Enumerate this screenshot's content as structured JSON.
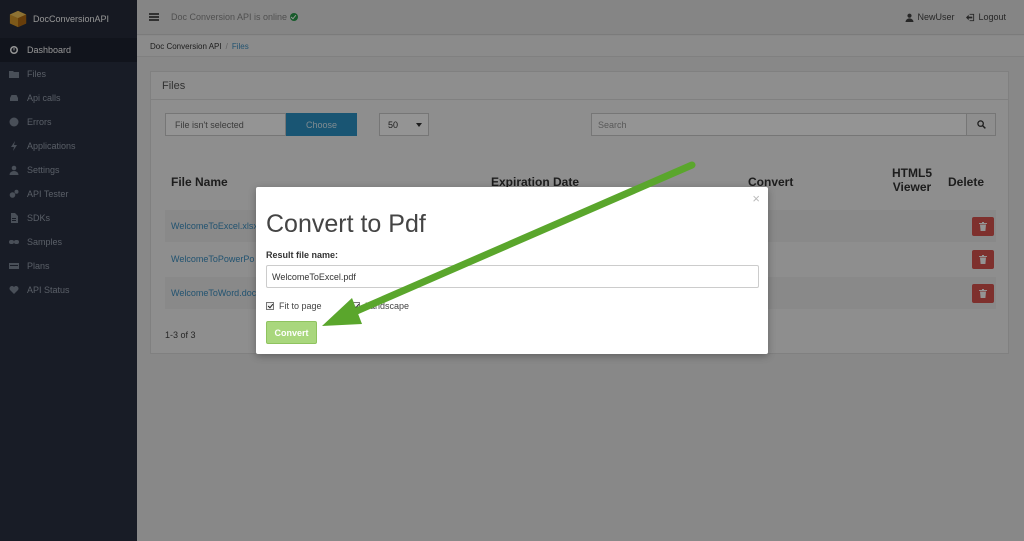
{
  "app": {
    "brand": "DocConversionAPI"
  },
  "topbar": {
    "status": "Doc Conversion API is online",
    "user": "NewUser",
    "logout": "Logout"
  },
  "sidebar": {
    "items": [
      {
        "label": "Dashboard",
        "icon": "dashboard-icon"
      },
      {
        "label": "Files",
        "icon": "folder-icon"
      },
      {
        "label": "Api calls",
        "icon": "car-icon"
      },
      {
        "label": "Errors",
        "icon": "error-icon"
      },
      {
        "label": "Applications",
        "icon": "bolt-icon"
      },
      {
        "label": "Settings",
        "icon": "user-icon"
      },
      {
        "label": "API Tester",
        "icon": "cogs-icon"
      },
      {
        "label": "SDKs",
        "icon": "file-icon"
      },
      {
        "label": "Samples",
        "icon": "link-icon"
      },
      {
        "label": "Plans",
        "icon": "credit-card-icon"
      },
      {
        "label": "API Status",
        "icon": "heart-icon"
      }
    ]
  },
  "breadcrumb": {
    "root": "Doc Conversion API",
    "sep": "/",
    "current": "Files"
  },
  "files": {
    "title": "Files",
    "file_input": "File isn't selected",
    "choose": "Choose",
    "page_size": "50",
    "search_placeholder": "Search",
    "headers": {
      "name": "File Name",
      "expiration": "Expiration Date",
      "convert": "Convert",
      "viewer_1": "HTML5",
      "viewer_2": "Viewer",
      "delete": "Delete"
    },
    "rows": [
      {
        "name": "WelcomeToExcel.xlsx"
      },
      {
        "name": "WelcomeToPowerPo"
      },
      {
        "name": "WelcomeToWord.doc"
      }
    ],
    "pager": "1-3 of 3"
  },
  "modal": {
    "title": "Convert to Pdf",
    "close": "×",
    "label": "Result file name:",
    "filename": "WelcomeToExcel.pdf",
    "fit_to_page": "Fit to page",
    "landscape": "Landscape",
    "convert": "Convert"
  },
  "colors": {
    "sidebar": "#2a3142",
    "accent": "#2b93c6",
    "success": "#a9d77d",
    "danger": "#d9534f",
    "arrow": "#5aa62c"
  }
}
